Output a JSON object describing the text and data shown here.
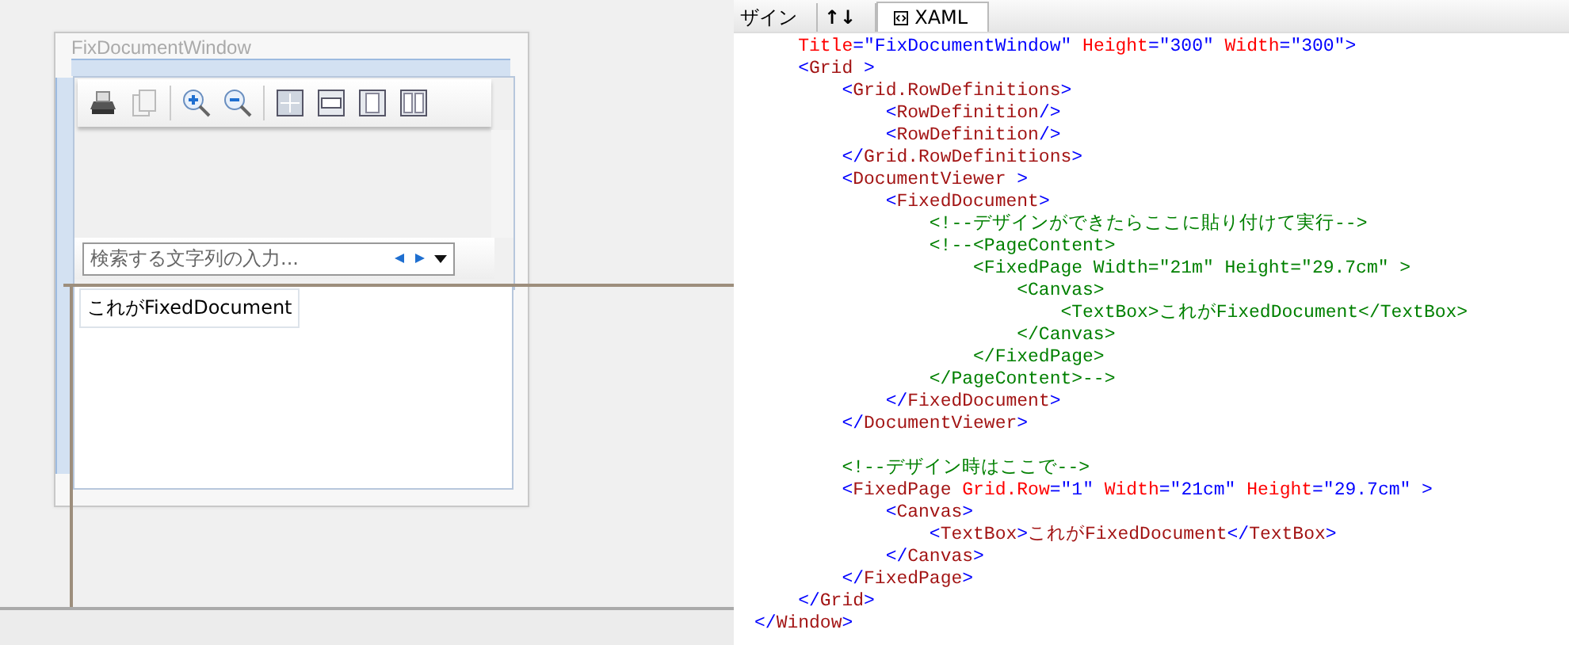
{
  "designer": {
    "window_title": "FixDocumentWindow",
    "search": {
      "placeholder": "検索する文字列の入力..."
    },
    "textbox": "これがFixedDocument"
  },
  "tabs": [
    {
      "label": "ザイン",
      "kind": "text",
      "selected": false
    },
    {
      "label": "↑↓",
      "kind": "swap",
      "selected": false
    },
    {
      "label": "XAML",
      "kind": "xaml",
      "selected": true
    }
  ],
  "code_lines": [
    {
      "children": [
        {
          "segments": [
            {
              "kind": "attr",
              "text": "Title"
            },
            {
              "kind": "value",
              "text": "=\"FixDocumentWindow\" "
            },
            {
              "kind": "attr",
              "text": "Height"
            },
            {
              "kind": "value",
              "text": "=\"300\" "
            },
            {
              "kind": "attr",
              "text": "Width"
            },
            {
              "kind": "value",
              "text": "=\"300\">"
            }
          ]
        },
        {
          "segments": [
            {
              "kind": "punct",
              "text": "<"
            },
            {
              "kind": "tag",
              "text": "Grid"
            },
            {
              "kind": "punct",
              "text": " >"
            }
          ],
          "children": [
            {
              "segments": [
                {
                  "kind": "punct",
                  "text": "<"
                },
                {
                  "kind": "tag",
                  "text": "Grid.RowDefinitions"
                },
                {
                  "kind": "punct",
                  "text": ">"
                }
              ],
              "children": [
                {
                  "segments": [
                    {
                      "kind": "punct",
                      "text": "<"
                    },
                    {
                      "kind": "tag",
                      "text": "RowDefinition"
                    },
                    {
                      "kind": "punct",
                      "text": "/>"
                    }
                  ]
                },
                {
                  "segments": [
                    {
                      "kind": "punct",
                      "text": "<"
                    },
                    {
                      "kind": "tag",
                      "text": "RowDefinition"
                    },
                    {
                      "kind": "punct",
                      "text": "/>"
                    }
                  ]
                }
              ]
            },
            {
              "segments": [
                {
                  "kind": "punct",
                  "text": "</"
                },
                {
                  "kind": "tag",
                  "text": "Grid.RowDefinitions"
                },
                {
                  "kind": "punct",
                  "text": ">"
                }
              ]
            },
            {
              "segments": [
                {
                  "kind": "punct",
                  "text": "<"
                },
                {
                  "kind": "tag",
                  "text": "DocumentViewer"
                },
                {
                  "kind": "punct",
                  "text": " >"
                }
              ],
              "children": [
                {
                  "segments": [
                    {
                      "kind": "punct",
                      "text": "<"
                    },
                    {
                      "kind": "tag",
                      "text": "FixedDocument"
                    },
                    {
                      "kind": "punct",
                      "text": ">"
                    }
                  ],
                  "children": [
                    {
                      "segments": [
                        {
                          "kind": "comment",
                          "text": "<!--デザインができたらここに貼り付けて実行-->"
                        }
                      ]
                    },
                    {
                      "segments": [
                        {
                          "kind": "comment",
                          "text": "<!--<PageContent>"
                        }
                      ],
                      "children": [
                        {
                          "segments": [
                            {
                              "kind": "comment",
                              "text": "<FixedPage Width=\"21m\" Height=\"29.7cm\" >"
                            }
                          ],
                          "children": [
                            {
                              "segments": [
                                {
                                  "kind": "comment",
                                  "text": "<Canvas>"
                                }
                              ],
                              "children": [
                                {
                                  "segments": [
                                    {
                                      "kind": "comment",
                                      "text": "<TextBox>これがFixedDocument</TextBox>"
                                    }
                                  ]
                                }
                              ]
                            },
                            {
                              "segments": [
                                {
                                  "kind": "comment",
                                  "text": "</Canvas>"
                                }
                              ]
                            }
                          ]
                        },
                        {
                          "segments": [
                            {
                              "kind": "comment",
                              "text": "</FixedPage>"
                            }
                          ]
                        }
                      ]
                    },
                    {
                      "segments": [
                        {
                          "kind": "comment",
                          "text": "</PageContent>-->"
                        }
                      ]
                    }
                  ]
                },
                {
                  "segments": [
                    {
                      "kind": "punct",
                      "text": "</"
                    },
                    {
                      "kind": "tag",
                      "text": "FixedDocument"
                    },
                    {
                      "kind": "punct",
                      "text": ">"
                    }
                  ]
                }
              ]
            },
            {
              "segments": [
                {
                  "kind": "punct",
                  "text": "</"
                },
                {
                  "kind": "tag",
                  "text": "DocumentViewer"
                },
                {
                  "kind": "punct",
                  "text": ">"
                }
              ]
            },
            {
              "kind": "blank"
            },
            {
              "segments": [
                {
                  "kind": "comment",
                  "text": "<!--デザイン時はここで-->"
                }
              ]
            },
            {
              "segments": [
                {
                  "kind": "punct",
                  "text": "<"
                },
                {
                  "kind": "tag",
                  "text": "FixedPage"
                },
                {
                  "kind": "attr",
                  "text": " Grid.Row"
                },
                {
                  "kind": "value",
                  "text": "=\"1\" "
                },
                {
                  "kind": "attr",
                  "text": "Width"
                },
                {
                  "kind": "value",
                  "text": "=\"21cm\" "
                },
                {
                  "kind": "attr",
                  "text": "Height"
                },
                {
                  "kind": "value",
                  "text": "=\"29.7cm\" >"
                }
              ],
              "children": [
                {
                  "segments": [
                    {
                      "kind": "punct",
                      "text": "<"
                    },
                    {
                      "kind": "tag",
                      "text": "Canvas"
                    },
                    {
                      "kind": "punct",
                      "text": ">"
                    }
                  ],
                  "children": [
                    {
                      "segments": [
                        {
                          "kind": "punct",
                          "text": "<"
                        },
                        {
                          "kind": "tag",
                          "text": "TextBox"
                        },
                        {
                          "kind": "punct",
                          "text": ">"
                        },
                        {
                          "kind": "tag",
                          "text": "これがFixedDocument"
                        },
                        {
                          "kind": "punct",
                          "text": "</"
                        },
                        {
                          "kind": "tag",
                          "text": "TextBox"
                        },
                        {
                          "kind": "punct",
                          "text": ">"
                        }
                      ]
                    }
                  ]
                },
                {
                  "segments": [
                    {
                      "kind": "punct",
                      "text": "</"
                    },
                    {
                      "kind": "tag",
                      "text": "Canvas"
                    },
                    {
                      "kind": "punct",
                      "text": ">"
                    }
                  ]
                }
              ]
            },
            {
              "segments": [
                {
                  "kind": "punct",
                  "text": "</"
                },
                {
                  "kind": "tag",
                  "text": "FixedPage"
                },
                {
                  "kind": "punct",
                  "text": ">"
                }
              ]
            }
          ]
        },
        {
          "segments": [
            {
              "kind": "punct",
              "text": "</"
            },
            {
              "kind": "tag",
              "text": "Grid"
            },
            {
              "kind": "punct",
              "text": ">"
            }
          ]
        }
      ]
    },
    {
      "segments": [
        {
          "kind": "punct",
          "text": "</"
        },
        {
          "kind": "tag",
          "text": "Window"
        },
        {
          "kind": "punct",
          "text": ">"
        }
      ]
    }
  ]
}
